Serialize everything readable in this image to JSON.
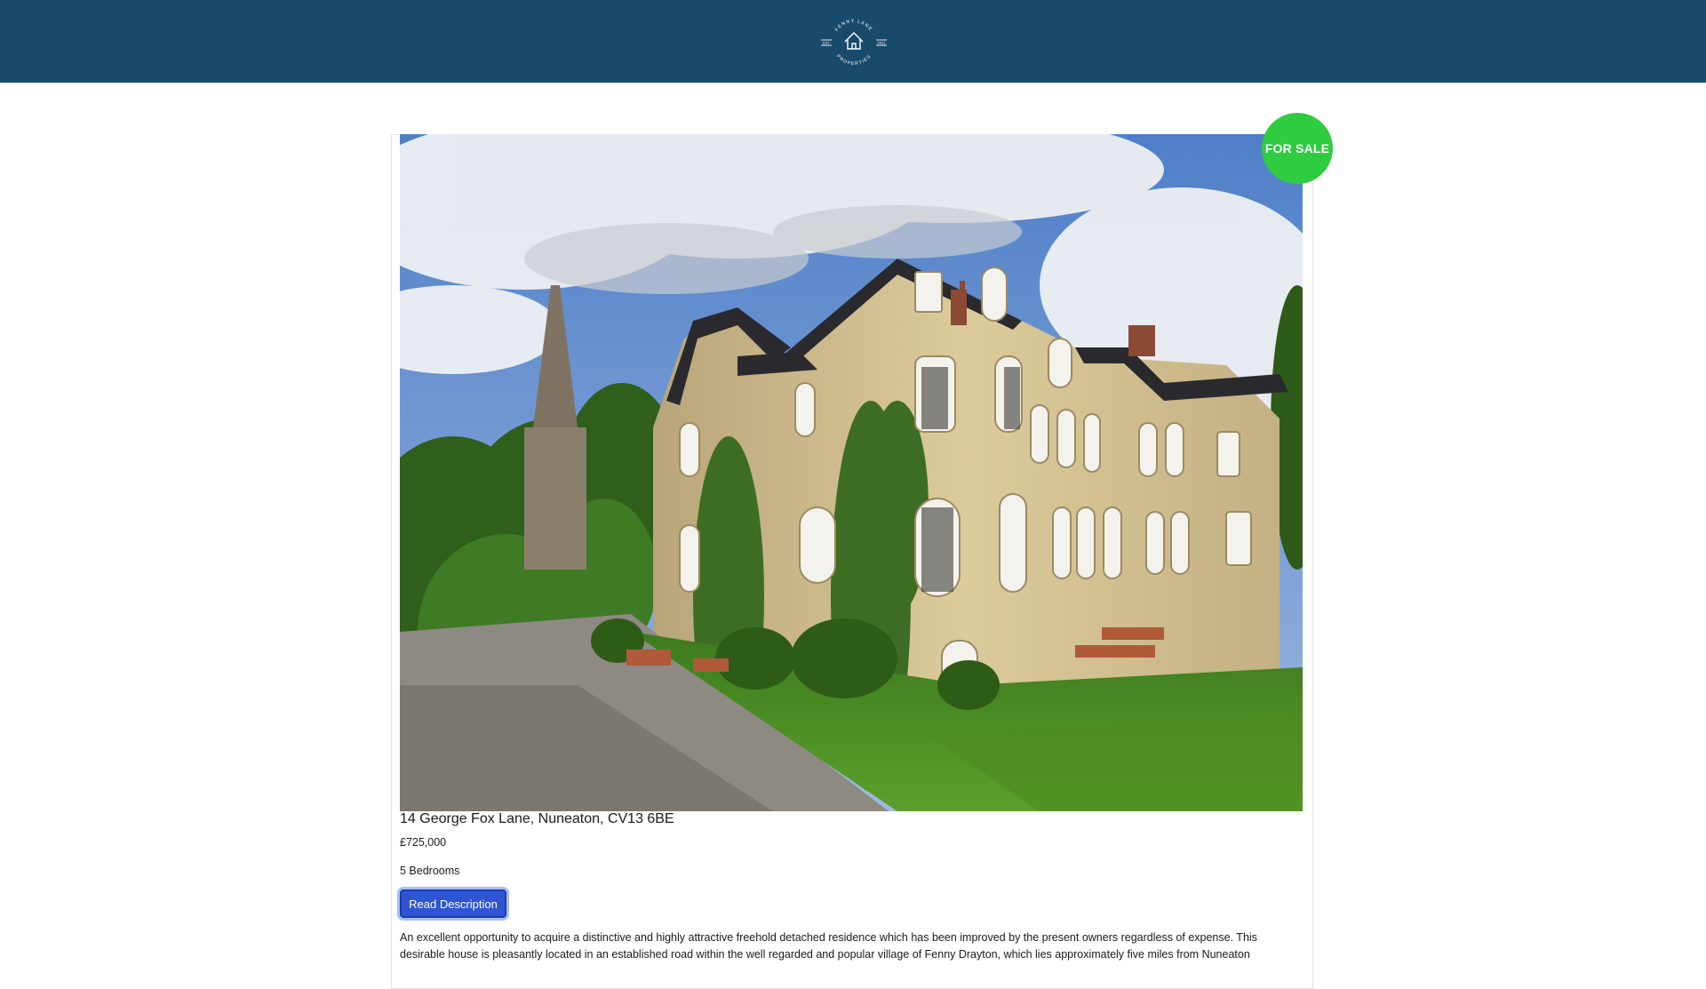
{
  "header": {
    "logo_top_text": "FENNY LANE",
    "logo_bottom_text": "PROPERTIES",
    "logo_left_text": "EST",
    "logo_right_text": "2021",
    "background_color": "#184a6c"
  },
  "listing": {
    "status_badge": "FOR SALE",
    "status_color": "#2ecc40",
    "address": "14 George Fox Lane, Nuneaton, CV13 6BE",
    "price": "£725,000",
    "bedrooms": "5 Bedrooms",
    "read_button_label": "Read Description",
    "description": "An excellent opportunity to acquire a distinctive and highly attractive freehold detached residence which has been improved by the present owners regardless of expense. This desirable house is pleasantly located in an established road within the well regarded and popular village of Fenny Drayton, which lies approximately five miles from Nuneaton"
  },
  "accent_colors": {
    "button": "#2f55d4"
  }
}
